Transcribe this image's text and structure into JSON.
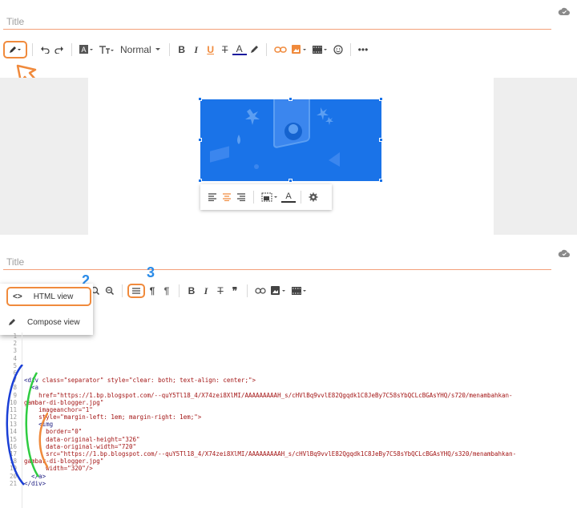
{
  "editor_top": {
    "title_placeholder": "Title",
    "toolbar": {
      "style_select": "Normal"
    }
  },
  "annotations": {
    "n1": "1",
    "n2": "2",
    "n3": "3"
  },
  "editor_bottom": {
    "title_placeholder": "Title",
    "view_menu": {
      "html_view": "HTML view",
      "compose_view": "Compose view"
    }
  },
  "code": {
    "line_numbers": [
      "1",
      "2",
      "3",
      "4",
      "5",
      "6",
      "7",
      "8",
      "9",
      "10",
      "11",
      "12",
      "13",
      "14",
      "15",
      "16",
      "17",
      "18",
      "19",
      "20",
      "21"
    ],
    "lines": [
      {
        "indent": "",
        "tag_open": "",
        "content": ""
      },
      {
        "indent": "",
        "tag_open": "",
        "content": ""
      },
      {
        "indent": "",
        "tag_open": "",
        "content": ""
      },
      {
        "indent": "",
        "tag_open": "",
        "content": ""
      },
      {
        "indent": "",
        "tag_open": "",
        "content": ""
      },
      {
        "indent": "",
        "tag_open": "",
        "content": ""
      },
      {
        "indent": "",
        "tag_open": "<div",
        "content": " class=\"separator\" style=\"clear: both; text-align: center;\">"
      },
      {
        "indent": "  ",
        "tag_open": "<a",
        "content": ""
      },
      {
        "indent": "    ",
        "tag_open": "",
        "content": "href=\"https://1.bp.blogspot.com/--quY5Tl18_4/X74zei8XlMI/AAAAAAAAAH_s/cHVlBq9vvlE82Qgqdk1C8JeBy7C58sYbQCLcBGAsYHQ/s720/menambahkan-"
      },
      {
        "indent": "",
        "tag_open": "",
        "content": "gambar-di-blogger.jpg\""
      },
      {
        "indent": "    ",
        "tag_open": "",
        "content": "imageanchor=\"1\""
      },
      {
        "indent": "    ",
        "tag_open": "",
        "content": "style=\"margin-left: 1em; margin-right: 1em;\">"
      },
      {
        "indent": "    ",
        "tag_open": "<img",
        "content": ""
      },
      {
        "indent": "      ",
        "tag_open": "",
        "content": "border=\"0\""
      },
      {
        "indent": "      ",
        "tag_open": "",
        "content": "data-original-height=\"326\""
      },
      {
        "indent": "      ",
        "tag_open": "",
        "content": "data-original-width=\"720\""
      },
      {
        "indent": "      ",
        "tag_open": "",
        "content": "src=\"https://1.bp.blogspot.com/--quY5Tl18_4/X74zei8XlMI/AAAAAAAAAH_s/cHVlBq9vvlE82Qgqdk1C8JeBy7C58sYbQCLcBGAsYHQ/s320/menambahkan-"
      },
      {
        "indent": "",
        "tag_open": "",
        "content": "gambar-di-blogger.jpg\""
      },
      {
        "indent": "      ",
        "tag_open": "",
        "content": "width=\"320\"/>"
      },
      {
        "indent": "  ",
        "tag_open": "</a>",
        "content": ""
      },
      {
        "indent": "",
        "tag_open": "</div>",
        "content": ""
      }
    ]
  },
  "colors": {
    "accent_orange": "#f08a3c",
    "annotation_blue": "#2a8be8",
    "image_blue": "#1a73e8",
    "bracket_green": "#2ecc40",
    "bracket_blue": "#1a3fd6",
    "bracket_orange": "#f08a3c"
  }
}
